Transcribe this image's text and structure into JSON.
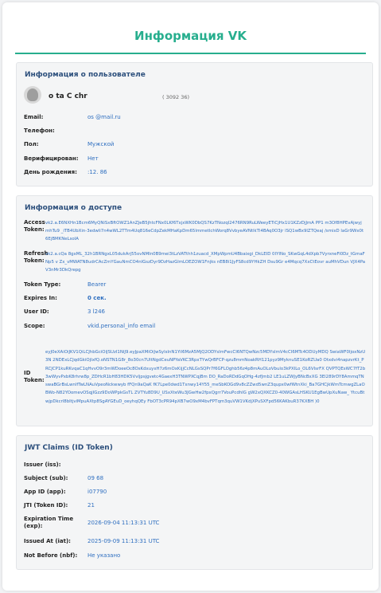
{
  "page": {
    "title": "Информация VK"
  },
  "user_info": {
    "heading": "Информация о пользователе",
    "name": "o      ta      C    chr",
    "id": "(   3092   36)",
    "rows": [
      {
        "label": "Email:",
        "value": "    os      @mail.ru"
      },
      {
        "label": "Телефон:",
        "value": ""
      },
      {
        "label": "Пол:",
        "value": "Мужской"
      },
      {
        "label": "Верифицирован:",
        "value": "Нет"
      },
      {
        "label": "День рождения:",
        "value": "      :12.     86"
      }
    ]
  },
  "access_info": {
    "heading": "Информация о доступе",
    "access_token_label": "Access Token:",
    "access_token": "vk2.a.E6NXHn1Bcm6MyQNiSxBftOWZ1AnZJeB5jhtcFNx0LKf6TxjxWK0DbQS7KzTNozqI2476RN9RuLWeeyETiCjHx1U1KZzDjJmA      PP1      m3Of8HPEvAjwyjmhTu9      _iTB4UbXin-3edwli7n4wWL2TTm4Uq816eCdpZekMHaKpDm65lmmetIchWorq8VvbyeAVNtlkTl4BAq0O3jr      lSQ1wBx9lZTQeaj      /smixD      laGr9Wx0t6EjBMKNeLsoIA",
    "refresh_token_label": "Refresh Token:",
    "refresh_token": "vk2.a.cQa      8gxML_32h1BRNgxL05dukArj55ovNMIn0B9mei3tLzVATthh1zuacd_XMpWpmU4Bbaixgi_DkLEID 0IYINo_SKwGqL4dXpb7VyrxneFi0Dz_tGmaFNp5 v      Zx_vMWATN8udrCAcZmYGauNmCO4nlGszDyr9DzHazGlmLOEZOW1Fnjks nEB8i1JyFS8cd9YHkZH  Dsu9Gr      e4Mqcq7XxCtEovr      auMhVDun      VJX4PaV3nMr3DkQrepg",
    "rows": [
      {
        "label": "Token Type:",
        "value": "Bearer"
      },
      {
        "label": "Expires In:",
        "value": "0 сек."
      },
      {
        "label": "User ID:",
        "value": "3      l246"
      },
      {
        "label": "Scope:",
        "value": "vkid.personal_info email"
      }
    ],
    "id_token_label": "ID Token:",
    "id_token": "eyJ0eXAiOiJKV1QiLCJhbGciOiJSUzI1NiJ9.eyJpaXMiOiJwSylsInN1YiI6MzA5MjQ2ODYsImFwcCI6NTQwNzc5MDYsImV4cCI6MTc4ODUyMDQ      SwiaWF0IjoxNzU3N      2NDExLCJqdGkiOjIxfQ.oNSTN1G8r_8o30cn7UltNgdCeuNPYaVKC3RpxTYwQrBFCP-qzu8mmNoakRH121pyz9MyknuSE1KoRZUa0      Otxdvi4napzvrKt_PRCJCP1kuRKvqaC1qHvvO9r3mWDoeeOc8OsKdxuyxH7z6mOxKijjCcNLGsSQPr7f6GFLOghb56z4p8mAuOLoVbulo3kPXILo_OL6VIsrFX QVPTQEsWC7fT2b3wWyvPxbK8rhrw8p_ZDHcR1bH83HDK5Vvljpsjgvetc4GaexH3TNWPXCqjBm      DO_RaDoRDdGqOHg-4zfJmb2 LE1uLZWJyBNcBxXG 3El289rDY8AmmqTNswaBGrBsLwnlfTwLNAuVpeoNckwwyb fFQn9aQaK      fK7Lpe0dwd1Txnwy14Y55_meSbKOGd9v8cZZwd5wnZ3qupx0wfWtnXki_Ba7GHCjkWmTcmwgZLaOBWo-N82YOomevOSqjIGzz9DoWPpkGsTL ZVTYu8D9U_USxXteWu3JGwHw2fpxQgrr7VouPcdhIG gW2xQXKCZ0-40WGAsLHSKU1EgBwUpXuNaw_ YtcuBtwjpDkcrl8bItjviMpuAXtp8SgAYGEuD_oeyhqQEy FbOT3cPR94pXB7wO9xM4bvFPTqm3quVW1VKdjXPuSXFpd56KAKbuR37KXBH      )0",
    "id_token_row_label": "ID Token:"
  },
  "jwt": {
    "heading": "JWT Claims (ID Token)",
    "rows": [
      {
        "label": "Issuer (iss):",
        "value": ""
      },
      {
        "label": "Subject (sub):",
        "value": "      09      68"
      },
      {
        "label": "App ID (app):",
        "value": "      i07790"
      },
      {
        "label": "JTI (Token ID):",
        "value": "21"
      },
      {
        "label": "Expiration Time (exp):",
        "value": "2026-09-04 11:13:31 UTC"
      },
      {
        "label": "Issued At (iat):",
        "value": "2025-09-09 11:13:31 UTC"
      },
      {
        "label": "Not Before (nbf):",
        "value": "Не указано"
      }
    ]
  },
  "colors": {
    "accent": "#27ae8e",
    "heading": "#2c4f7c",
    "value": "#2f6fc0"
  },
  "icons": {
    "avatar": "user-avatar"
  }
}
